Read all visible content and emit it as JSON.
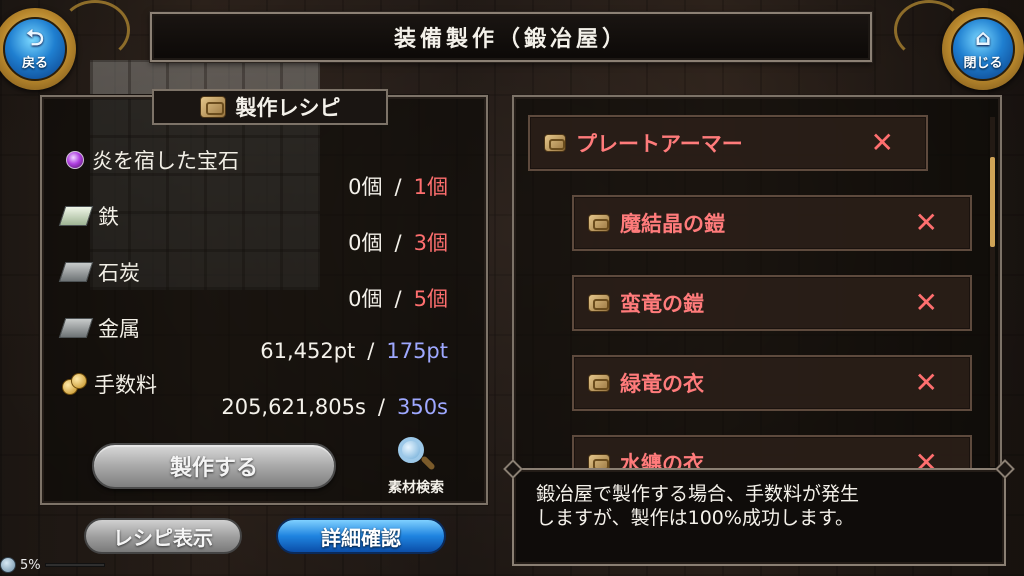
{
  "header": {
    "title": "装備製作（鍛冶屋）"
  },
  "nav": {
    "back": {
      "label": "戻る",
      "icon": "return-arrow-icon",
      "glyph": "⮌"
    },
    "close": {
      "label": "閉じる",
      "icon": "home-icon",
      "glyph": "⌂"
    }
  },
  "recipe": {
    "title": "製作レシピ",
    "materials": [
      {
        "name": "炎を宿した宝石",
        "icon": "gem-icon",
        "have": "0個",
        "need": "1個",
        "need_color": "red"
      },
      {
        "name": "鉄",
        "icon": "iron-ingot-icon",
        "have": "0個",
        "need": "3個",
        "need_color": "red"
      },
      {
        "name": "石炭",
        "icon": "coal-ingot-icon",
        "have": "0個",
        "need": "5個",
        "need_color": "red"
      },
      {
        "name": "金属",
        "icon": "metal-ingot-icon",
        "have": "61,452pt",
        "need": "175pt",
        "need_color": "blue"
      },
      {
        "name": "手数料",
        "icon": "coin-icon",
        "have": "205,621,805s",
        "need": "350s",
        "need_color": "blue"
      }
    ],
    "separator": "/",
    "craft_label": "製作する",
    "search_label": "素材検索"
  },
  "bottom": {
    "recipe_view_label": "レシピ表示",
    "detail_label": "詳細確認"
  },
  "battery": {
    "text": "5%",
    "level": 0.05
  },
  "tree": {
    "root": {
      "name": "プレートアーマー"
    },
    "children": [
      {
        "name": "魔結晶の鎧"
      },
      {
        "name": "蛮竜の鎧"
      },
      {
        "name": "緑竜の衣"
      },
      {
        "name": "水纏の衣"
      }
    ],
    "remove_glyph": "✕"
  },
  "info": {
    "text": "鍛冶屋で製作する場合、手数料が発生\nしますが、製作は100%成功します。"
  },
  "colors": {
    "need_red": "#ff6f6f",
    "need_blue": "#9ea8ff",
    "item_name": "#ff7b7b",
    "accent_blue": "#1f84e0",
    "gold": "#cfa356"
  }
}
